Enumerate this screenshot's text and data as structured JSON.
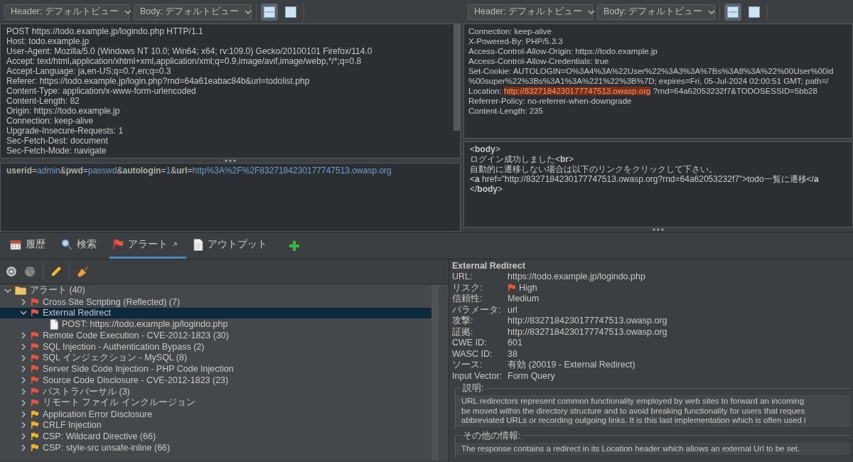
{
  "panes": [
    {
      "header_view": "Header: デフォルトビュー",
      "body_view": "Body: デフォルトビュー",
      "layout_buttons": [
        {
          "selected": true
        },
        {
          "selected": false
        }
      ],
      "header_lines": [
        {
          "kind": "plain",
          "text": "POST https://todo.example.jp/logindo.php HTTP/1.1"
        },
        {
          "kind": "plain",
          "text": "Host: todo.example.jp"
        },
        {
          "kind": "plain",
          "text": "User-Agent: Mozilla/5.0 (Windows NT 10.0; Win64; x64; rv:109.0) Gecko/20100101 Firefox/114.0"
        },
        {
          "kind": "plain",
          "text": "Accept: text/html,application/xhtml+xml,application/xml;q=0.9,image/avif,image/webp,*/*;q=0.8"
        },
        {
          "kind": "plain",
          "text": "Accept-Language: ja,en-US;q=0.7,en;q=0.3"
        },
        {
          "kind": "plain",
          "text": "Referer: https://todo.example.jp/login.php?rnd=64a61eabac84b&url=todolist.php"
        },
        {
          "kind": "plain",
          "text": "Content-Type: application/x-www-form-urlencoded"
        },
        {
          "kind": "plain",
          "text": "Content-Length: 82"
        },
        {
          "kind": "plain",
          "text": "Origin: https://todo.example.jp"
        },
        {
          "kind": "plain",
          "text": "Connection: keep-alive"
        },
        {
          "kind": "plain",
          "text": "Upgrade-Insecure-Requests: 1"
        },
        {
          "kind": "plain",
          "text": "Sec-Fetch-Dest: document"
        },
        {
          "kind": "plain",
          "text": "Sec-Fetch-Mode: navigate"
        }
      ],
      "body_tokens": [
        {
          "kind": "key",
          "text": "userid"
        },
        {
          "kind": "op",
          "text": "="
        },
        {
          "kind": "value",
          "text": "admin"
        },
        {
          "kind": "op",
          "text": "&"
        },
        {
          "kind": "key",
          "text": "pwd"
        },
        {
          "kind": "op",
          "text": "="
        },
        {
          "kind": "value",
          "text": "passwd"
        },
        {
          "kind": "op",
          "text": "&"
        },
        {
          "kind": "key",
          "text": "autologin"
        },
        {
          "kind": "op",
          "text": "="
        },
        {
          "kind": "value",
          "text": "1"
        },
        {
          "kind": "op",
          "text": "&"
        },
        {
          "kind": "key",
          "text": "url"
        },
        {
          "kind": "op",
          "text": "="
        },
        {
          "kind": "value",
          "text": "http%3A%2F%2F8327184230177747513.owasp.org"
        }
      ]
    },
    {
      "header_view": "Header: デフォルトビュー",
      "body_view": "Body: デフォルトビュー",
      "layout_buttons": [
        {
          "selected": true
        },
        {
          "selected": false
        }
      ],
      "header_lines": [
        {
          "kind": "plain",
          "text": "Connection: keep-alive"
        },
        {
          "kind": "plain",
          "text": "X-Powered-By: PHP/5.3.3"
        },
        {
          "kind": "plain",
          "text": "Access-Control-Allow-Origin: https://todo.example.jp"
        },
        {
          "kind": "plain",
          "text": "Access-Control-Allow-Credentials: true"
        },
        {
          "kind": "plain",
          "text": "Set-Cookie: AUTOLOGIN=O%3A4%3A%22User%22%3A3%3A%7Bs%3A8%3A%22%00User%00id"
        },
        {
          "kind": "plain",
          "text": "%00super%22%3Bs%3A1%3A%221%22%3B%7D; expires=Fri, 05-Jul-2024 02:00:51 GMT; path=/"
        },
        {
          "kind": "segmented",
          "segments": [
            {
              "text": "Location:",
              "highlighted": false
            },
            {
              "text": "http://8327184230177747513.owasp.org",
              "highlighted": true
            },
            {
              "text": "?rnd=64a62053232f7&TODOSESSID=5bb28",
              "highlighted": false
            }
          ]
        },
        {
          "kind": "plain",
          "text": "Referrer-Policy: no-referrer-when-downgrade"
        },
        {
          "kind": "plain",
          "text": "Content-Length: 235"
        }
      ],
      "body_lines": [
        "<**body**>",
        "ログイン成功しました<**br**>",
        "自動的に遷移しない場合は以下のリンクをクリックして下さい。",
        "<**a** href=\"http://8327184230177747513.owasp.org?rnd=64a62053232f7\">todo一覧に遷移</**a**",
        "</**body**>"
      ]
    }
  ],
  "tabs": [
    {
      "label": "履歴",
      "selected": false
    },
    {
      "label": "検索",
      "selected": false
    },
    {
      "label": "アラート",
      "selected": true
    },
    {
      "label": "アウトプット",
      "selected": false
    }
  ],
  "alert_tree": {
    "label": "アラート (40)",
    "expanded": true,
    "selected": false,
    "children": [
      {
        "label": "Cross Site Scripting (Reflected) (7)",
        "color": "#e8553d",
        "expanded": false,
        "selected": false
      },
      {
        "label": "External Redirect",
        "color": "#e8553d",
        "expanded": true,
        "selected": true,
        "children": [
          {
            "label": "POST: https://todo.example.jp/logindo.php",
            "selected": false
          }
        ]
      },
      {
        "label": "Remote Code Execution - CVE-2012-1823 (30)",
        "color": "#e8553d",
        "expanded": false,
        "selected": false
      },
      {
        "label": "SQL Injection - Authentication Bypass (2)",
        "color": "#e8553d",
        "expanded": false,
        "selected": false
      },
      {
        "label": "SQL インジェクション - MySQL (8)",
        "color": "#e8553d",
        "expanded": false,
        "selected": false
      },
      {
        "label": "Server Side Code Injection - PHP Code Injection",
        "color": "#e8553d",
        "expanded": false,
        "selected": false
      },
      {
        "label": "Source Code Disclosure - CVE-2012-1823 (23)",
        "color": "#e8553d",
        "expanded": false,
        "selected": false
      },
      {
        "label": "パストラバーサル (3)",
        "color": "#e8553d",
        "expanded": false,
        "selected": false
      },
      {
        "label": "リモート ファイル インクルージョン",
        "color": "#e8553d",
        "expanded": false,
        "selected": false
      },
      {
        "label": "Application Error Disclosure",
        "color": "#f0b429",
        "expanded": false,
        "selected": false
      },
      {
        "label": "CRLF Injection",
        "color": "#f0b429",
        "expanded": false,
        "selected": false
      },
      {
        "label": "CSP: Wildcard Directive (66)",
        "color": "#f0b429",
        "expanded": false,
        "selected": false
      },
      {
        "label": "CSP: style-src unsafe-inline (66)",
        "color": "#f0b429",
        "expanded": false,
        "selected": false
      }
    ]
  },
  "details": {
    "title": "External Redirect",
    "fields": [
      {
        "kind": "text",
        "label": "URL:",
        "value": "https://todo.example.jp/logindo.php"
      },
      {
        "kind": "risk",
        "label": "リスク:",
        "value": "High",
        "color": "#e8553d"
      },
      {
        "kind": "text",
        "label": "信頼性:",
        "value": "Medium"
      },
      {
        "kind": "text",
        "label": "パラメータ:",
        "value": "url"
      },
      {
        "kind": "text",
        "label": "攻撃:",
        "value": "http://8327184230177747513.owasp.org"
      },
      {
        "kind": "text",
        "label": "証拠:",
        "value": "http://8327184230177747513.owasp.org"
      },
      {
        "kind": "text",
        "label": "CWE ID:",
        "value": "601"
      },
      {
        "kind": "text",
        "label": "WASC ID:",
        "value": "38"
      },
      {
        "kind": "text",
        "label": "ソース:",
        "value": "有効 (20019 - External Redirect)"
      },
      {
        "kind": "text",
        "label": "Input Vector:",
        "value": "Form Query"
      }
    ],
    "sections": [
      {
        "legend": "説明:",
        "lines": [
          "URL redirectors represent common functionality employed by web sites to forward an incoming",
          "be moved within the directory structure and to avoid breaking functionality for users that reques",
          "abbreviated URLs or recording outgoing links. It is this last implementation which is often used i"
        ]
      },
      {
        "legend": "その他の情報:",
        "lines": [
          "The response contains a redirect in its Location header which allows an external Url to be set."
        ]
      }
    ]
  }
}
